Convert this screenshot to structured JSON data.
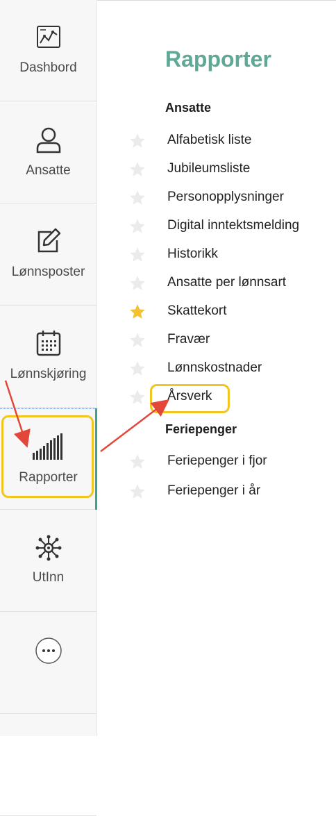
{
  "sidebar": {
    "items": [
      {
        "label": "Dashbord",
        "icon": "dashboard-chart-icon"
      },
      {
        "label": "Ansatte",
        "icon": "person-icon"
      },
      {
        "label": "Lønnsposter",
        "icon": "edit-icon"
      },
      {
        "label": "Lønnskjøring",
        "icon": "calendar-icon"
      },
      {
        "label": "Rapporter",
        "icon": "bar-chart-icon",
        "active": true
      },
      {
        "label": "UtInn",
        "icon": "hub-icon"
      },
      {
        "label": "",
        "icon": "more-icon"
      }
    ]
  },
  "main": {
    "title": "Rapporter",
    "sections": [
      {
        "heading": "Ansatte",
        "reports": [
          {
            "label": "Alfabetisk liste",
            "starred": false
          },
          {
            "label": "Jubileumsliste",
            "starred": false
          },
          {
            "label": "Personopplysninger",
            "starred": false
          },
          {
            "label": "Digital inntektsmelding",
            "starred": false
          },
          {
            "label": "Historikk",
            "starred": false
          },
          {
            "label": "Ansatte per lønnsart",
            "starred": false
          },
          {
            "label": "Skattekort",
            "starred": true
          },
          {
            "label": "Fravær",
            "starred": false
          },
          {
            "label": "Lønnskostnader",
            "starred": false
          },
          {
            "label": "Årsverk",
            "starred": false,
            "highlighted": true
          }
        ]
      },
      {
        "heading": "Feriepenger",
        "reports": [
          {
            "label": "Feriepenger i fjor",
            "starred": false
          },
          {
            "label": "Feriepenger i år",
            "starred": false
          }
        ]
      }
    ]
  },
  "colors": {
    "accent": "#5fa896",
    "active_bar": "#3aa38f",
    "star_on": "#f2c233",
    "star_off": "#ebebeb",
    "highlight": "#f2c521",
    "annotation_arrow": "#e2473a"
  }
}
